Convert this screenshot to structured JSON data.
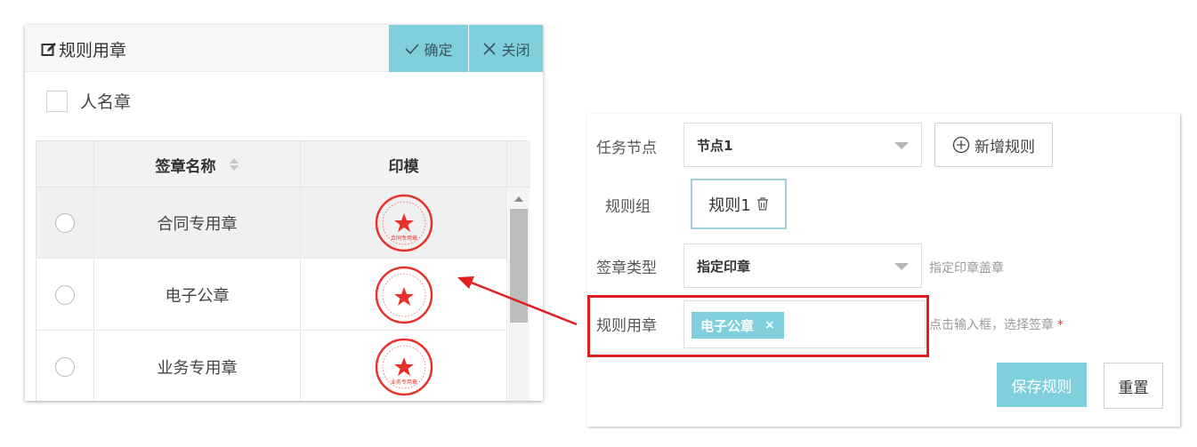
{
  "dialog": {
    "title": "规则用章",
    "confirm_label": "确定",
    "close_label": "关闭",
    "checkbox_label": "人名章",
    "table": {
      "columns": [
        "签章名称",
        "印模"
      ],
      "rows": [
        {
          "name": "合同专用章",
          "seal_label": "合同专用章",
          "selected": false
        },
        {
          "name": "电子公章",
          "seal_label": "",
          "selected": false
        },
        {
          "name": "业务专用章",
          "seal_label": "业务专用章",
          "selected": false
        }
      ],
      "seal_ring_text": "上海某某电子科技有限公司"
    }
  },
  "form": {
    "task_node_label": "任务节点",
    "task_node_value": "节点1",
    "add_rule_label": "新增规则",
    "rule_group_label": "规则组",
    "rule_tag": "规则1",
    "sign_type_label": "签章类型",
    "sign_type_value": "指定印章",
    "sign_type_hint": "指定印章盖章",
    "rule_seal_label": "规则用章",
    "rule_seal_chip": "电子公章",
    "rule_seal_hint": "点击输入框，选择签章",
    "required_mark": "*",
    "save_label": "保存规则",
    "reset_label": "重置"
  },
  "colors": {
    "accent": "#7fd0dc",
    "highlight": "#e02020",
    "seal_red": "#e8312a"
  }
}
